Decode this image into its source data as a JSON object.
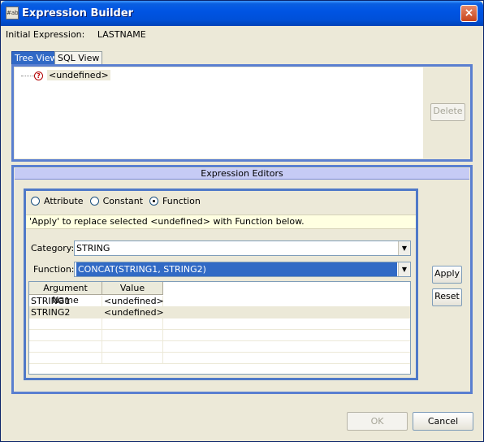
{
  "window": {
    "title": "Expression Builder",
    "close_glyph": "×",
    "icon_glyph": "#ab"
  },
  "initial_expression": {
    "label": "Initial Expression:",
    "value": "LASTNAME"
  },
  "tabs": [
    {
      "label": "Tree View",
      "active": true
    },
    {
      "label": "SQL View",
      "active": false
    }
  ],
  "tree": {
    "node_label": "<undefined>",
    "node_icon": "question-icon",
    "icon_glyph": "?"
  },
  "delete_button": {
    "label": "Delete",
    "enabled": false
  },
  "editors": {
    "header": "Expression Editors",
    "radios": [
      {
        "label": "Attribute",
        "checked": false
      },
      {
        "label": "Constant",
        "checked": false
      },
      {
        "label": "Function",
        "checked": true
      }
    ],
    "hint": "'Apply' to replace selected <undefined> with Function below.",
    "category": {
      "label": "Category:",
      "value": "STRING"
    },
    "function": {
      "label": "Function:",
      "value": "CONCAT(STRING1, STRING2)"
    },
    "table": {
      "columns": [
        "Argument Name",
        "Value"
      ],
      "rows": [
        {
          "name": "STRING1",
          "value": "<undefined>"
        },
        {
          "name": "STRING2",
          "value": "<undefined>"
        }
      ]
    },
    "apply_label": "Apply",
    "reset_label": "Reset"
  },
  "footer": {
    "ok_label": "OK",
    "cancel_label": "Cancel"
  },
  "colors": {
    "title_bar": "#0054e3",
    "panel_border": "#5a7fd0",
    "header_band": "#c6cbf5",
    "hint_bg": "#ffffe1",
    "selection": "#316ac5"
  }
}
